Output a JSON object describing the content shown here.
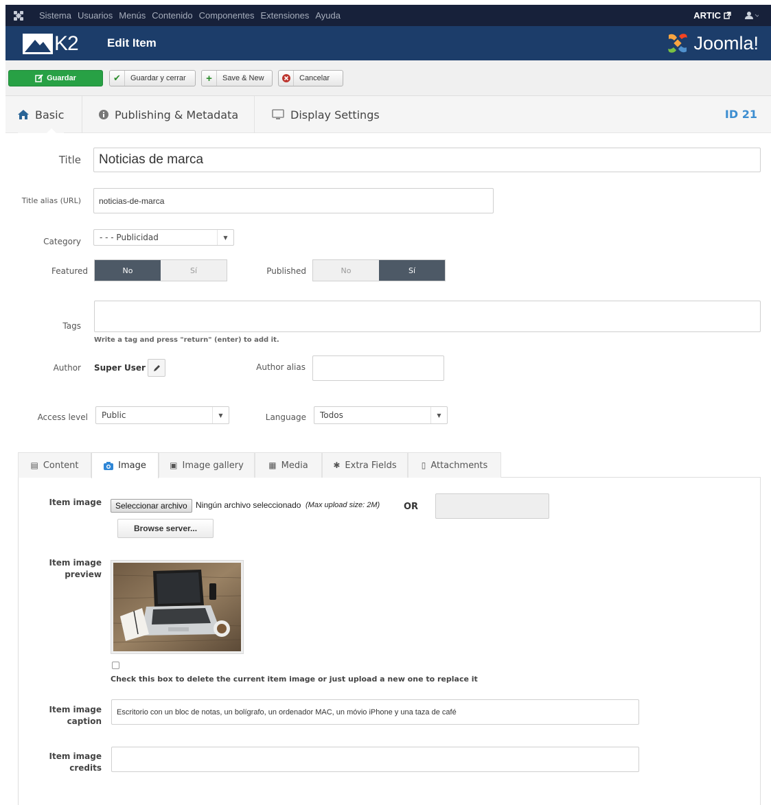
{
  "topbar": {
    "menu": [
      "Sistema",
      "Usuarios",
      "Menús",
      "Contenido",
      "Componentes",
      "Extensiones",
      "Ayuda"
    ],
    "site_name": "ARTIC",
    "user_icon": "user-icon"
  },
  "header": {
    "brand": "K2",
    "title": "Edit Item",
    "joomla_brand": "Joomla!"
  },
  "toolbar": {
    "save": "Guardar",
    "save_close": "Guardar y cerrar",
    "save_new": "Save & New",
    "cancel": "Cancelar"
  },
  "main_tabs": {
    "basic": "Basic",
    "publishing": "Publishing & Metadata",
    "display": "Display Settings",
    "item_id": "ID 21"
  },
  "form": {
    "title_label": "Title",
    "title_value": "Noticias de marca",
    "alias_label": "Title alias (URL)",
    "alias_value": "noticias-de-marca",
    "category_label": "Category",
    "category_value": "- - - Publicidad",
    "featured_label": "Featured",
    "featured_no": "No",
    "featured_yes": "Sí",
    "featured_value": "No",
    "published_label": "Published",
    "published_no": "No",
    "published_yes": "Sí",
    "published_value": "Sí",
    "tags_label": "Tags",
    "tags_hint": "Write a tag and press \"return\" (enter) to add it.",
    "author_label": "Author",
    "author_value": "Super User",
    "author_alias_label": "Author alias",
    "access_label": "Access level",
    "access_value": "Public",
    "language_label": "Language",
    "language_value": "Todos"
  },
  "sub_tabs": {
    "content": "Content",
    "image": "Image",
    "gallery": "Image gallery",
    "media": "Media",
    "extra": "Extra Fields",
    "attachments": "Attachments",
    "active": "Image"
  },
  "image_panel": {
    "item_image_label": "Item image",
    "file_button": "Seleccionar archivo",
    "no_file": "Ningún archivo seleccionado",
    "max_upload": "(Max upload size: 2M)",
    "or": "OR",
    "browse": "Browse server...",
    "preview_label_1": "Item image",
    "preview_label_2": "preview",
    "delete_hint": "Check this box to delete the current item image or just upload a new one to replace it",
    "caption_label_1": "Item image",
    "caption_label_2": "caption",
    "caption_value": "Escritorio con un bloc de notas, un bolígrafo, un ordenador MAC, un móvio iPhone y una taza de café",
    "credits_label_1": "Item image",
    "credits_label_2": "credits",
    "credits_value": ""
  },
  "colors": {
    "topbar": "#17213a",
    "header": "#1c3d6a",
    "save_green": "#28a145",
    "toggle_active": "#4d5966",
    "id_blue": "#3c8dd0"
  }
}
